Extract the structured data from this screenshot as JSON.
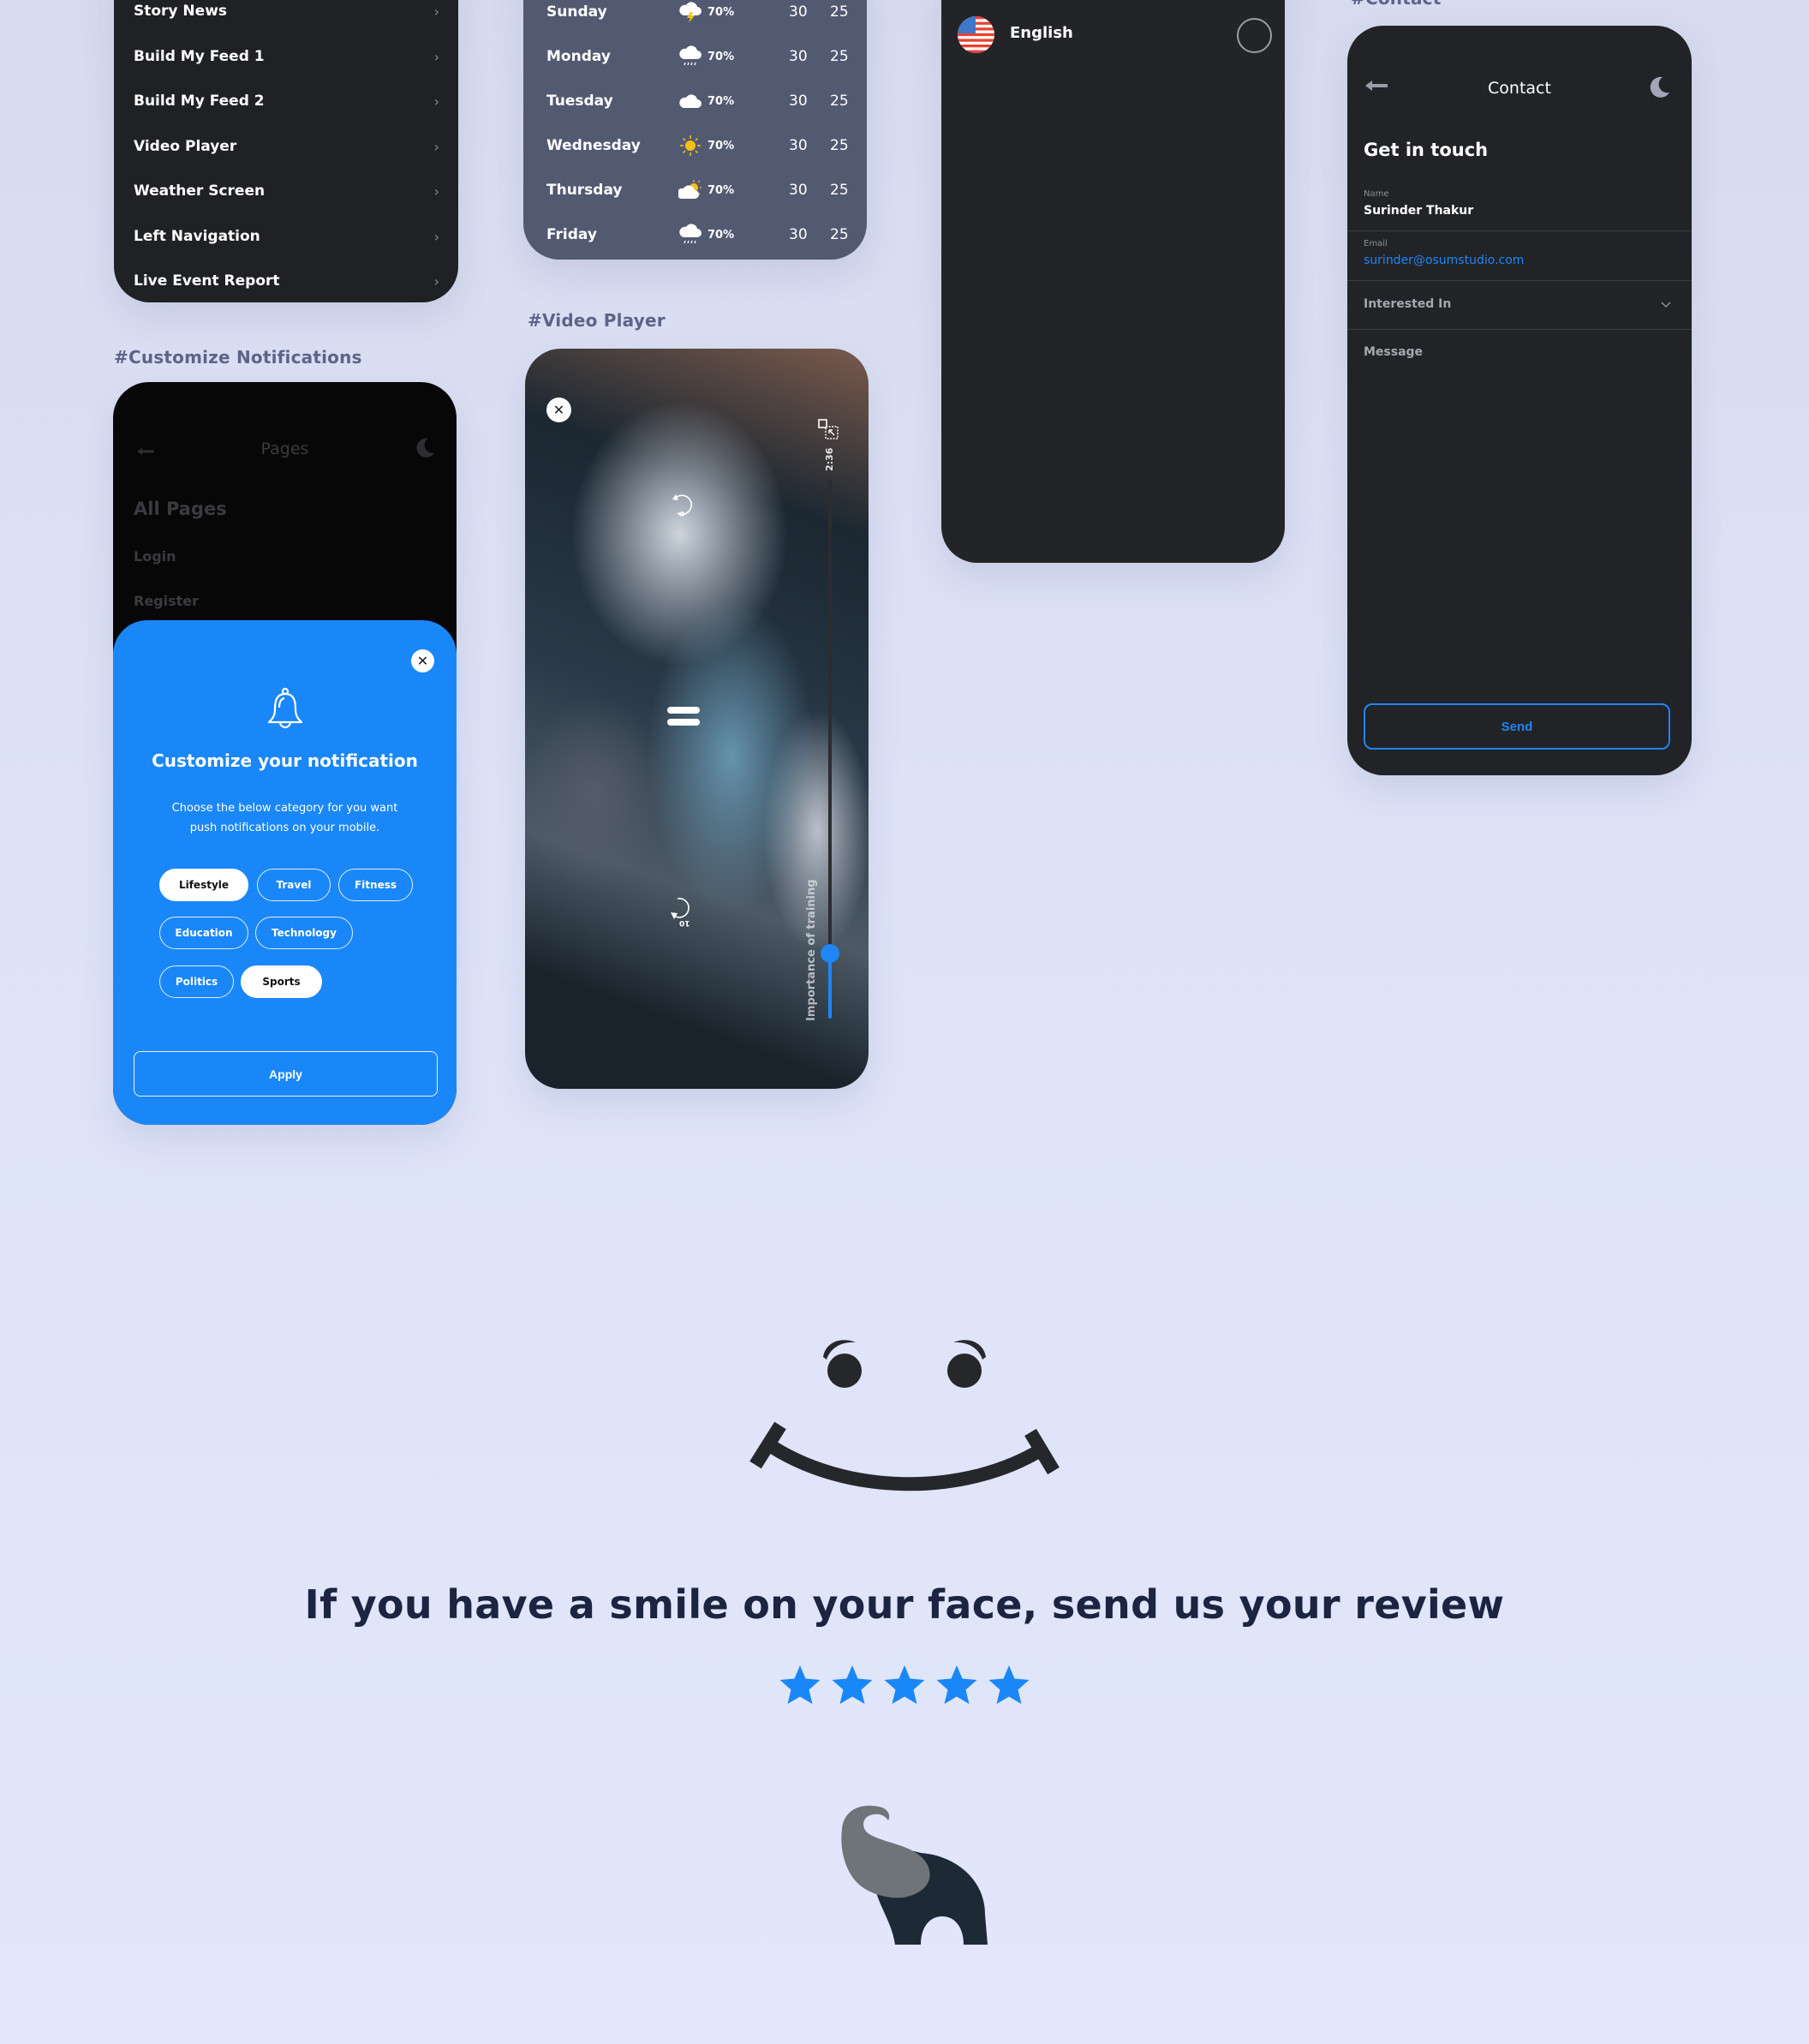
{
  "menu": {
    "items": [
      {
        "label": "Story News"
      },
      {
        "label": "Build My Feed 1"
      },
      {
        "label": "Build My Feed 2"
      },
      {
        "label": "Video Player"
      },
      {
        "label": "Weather Screen"
      },
      {
        "label": "Left Navigation"
      },
      {
        "label": "Live Event Report"
      }
    ],
    "chevron": "›"
  },
  "weather": {
    "rows": [
      {
        "day": "Sunday",
        "icon": "thunderstorm-icon",
        "precip": "70%",
        "high": "30",
        "low": "25"
      },
      {
        "day": "Monday",
        "icon": "rain-cloud-icon",
        "precip": "70%",
        "high": "30",
        "low": "25"
      },
      {
        "day": "Tuesday",
        "icon": "cloud-icon",
        "precip": "70%",
        "high": "30",
        "low": "25"
      },
      {
        "day": "Wednesday",
        "icon": "sun-icon",
        "precip": "70%",
        "high": "30",
        "low": "25"
      },
      {
        "day": "Thursday",
        "icon": "partly-cloudy-icon",
        "precip": "70%",
        "high": "30",
        "low": "25"
      },
      {
        "day": "Friday",
        "icon": "rain-cloud-icon",
        "precip": "70%",
        "high": "30",
        "low": "25"
      }
    ]
  },
  "language": {
    "items": [
      {
        "label": "English",
        "flag": "us-flag-icon",
        "selected": false
      }
    ]
  },
  "contact": {
    "section_label": "#Contact",
    "title": "Contact",
    "heading": "Get in touch",
    "name_label": "Name",
    "name_value": "Surinder Thakur",
    "email_label": "Email",
    "email_value": "surinder@osumstudio.com",
    "interest_placeholder": "Interested In",
    "message_placeholder": "Message",
    "send_label": "Send"
  },
  "notifications": {
    "section_label": "#Customize Notifications",
    "background": {
      "title": "Pages",
      "heading": "All Pages",
      "items": [
        {
          "label": "Login"
        },
        {
          "label": "Register"
        }
      ]
    },
    "sheet": {
      "title": "Customize your notification",
      "description_line1": "Choose the below category for you want",
      "description_line2": "push notifications on your mobile.",
      "chips": [
        {
          "label": "Lifestyle",
          "selected": true
        },
        {
          "label": "Travel",
          "selected": false
        },
        {
          "label": "Fitness",
          "selected": false
        },
        {
          "label": "Education",
          "selected": false
        },
        {
          "label": "Technology",
          "selected": false
        },
        {
          "label": "Politics",
          "selected": false
        },
        {
          "label": "Sports",
          "selected": true
        }
      ],
      "apply_label": "Apply",
      "close_glyph": "✕"
    }
  },
  "video": {
    "section_label": "#Video Player",
    "title": "Importance of training",
    "time": "2:36",
    "progress_percent": 12,
    "skip_seconds": "10",
    "close_glyph": "✕"
  },
  "review": {
    "headline": "If you have a smile on your face, send us your review",
    "rating": 5,
    "max_rating": 5
  },
  "colors": {
    "accent": "#1a87f8",
    "dark_card": "#222326",
    "weather_card": "#525a72",
    "headline": "#1b2440"
  }
}
